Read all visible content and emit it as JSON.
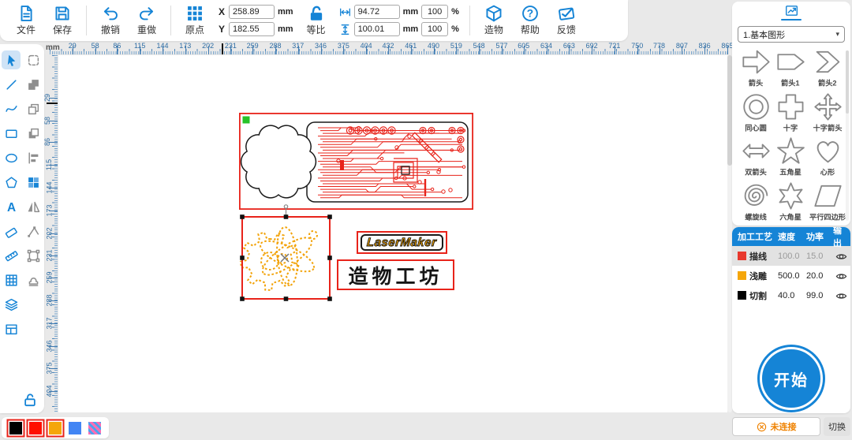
{
  "colors": {
    "accent": "#1584d6",
    "red": "#e8231a",
    "orange": "#f2a30a",
    "ruler_blue": "#2e6da4",
    "green_marker": "#27c227"
  },
  "toolbar": {
    "file_label": "文件",
    "save_label": "保存",
    "undo_label": "撤销",
    "redo_label": "重做",
    "origin_label": "原点",
    "x_label": "X",
    "x_value": "258.89",
    "y_label": "Y",
    "y_value": "182.55",
    "pos_unit": "mm",
    "lock_label": "等比",
    "width_value": "94.72",
    "height_value": "100.01",
    "size_unit": "mm",
    "width_percent": "100",
    "height_percent": "100",
    "percent_sign": "%",
    "build_label": "造物",
    "help_label": "帮助",
    "feedback_label": "反馈"
  },
  "left_toolbar": {
    "rows": [
      [
        "select",
        "marquee"
      ],
      [
        "line",
        "union"
      ],
      [
        "curve",
        "copy"
      ],
      [
        "rect",
        "subtract"
      ],
      [
        "ellipse",
        "align"
      ],
      [
        "polygon",
        "colorgrid"
      ],
      [
        "text",
        "mirror"
      ],
      [
        "eraser",
        "nodeedit"
      ],
      [
        "ruler",
        "frame"
      ],
      [
        "grid",
        "stamp"
      ],
      [
        "layers",
        null
      ],
      [
        "layout",
        null
      ]
    ],
    "active_tool": "select"
  },
  "rulers": {
    "unit": "mm",
    "h_numbers": [
      29,
      58,
      86,
      115,
      144,
      173,
      202,
      231,
      259,
      288,
      317,
      346,
      375,
      404,
      432,
      461,
      490,
      519,
      548,
      577,
      605,
      634,
      663,
      692,
      721,
      750,
      778,
      807,
      836,
      865
    ],
    "v_numbers": [
      29,
      58,
      86,
      115,
      144,
      173,
      202,
      231,
      259,
      288,
      317,
      346,
      375,
      404
    ]
  },
  "canvas": {
    "logo_text": "LaserMaker",
    "caption_text": "造物工坊",
    "objects": [
      "circuit-board-drawing",
      "gear-atom-group",
      "lasermaker-logo",
      "caption-text"
    ]
  },
  "palette": {
    "swatches": [
      {
        "id": "black",
        "color": "#000000",
        "outlined": true
      },
      {
        "id": "red",
        "color": "#ff0f00",
        "outlined": true
      },
      {
        "id": "orange",
        "color": "#f5a60a",
        "outlined": true
      },
      {
        "id": "blue",
        "color": "#4285f4",
        "outlined": false
      },
      {
        "id": "rainbow",
        "color": "rainbow",
        "outlined": false
      }
    ]
  },
  "library": {
    "category": "1.基本图形",
    "shapes": [
      {
        "id": "arrow",
        "label": "箭头"
      },
      {
        "id": "arrow1",
        "label": "箭头1"
      },
      {
        "id": "arrow2",
        "label": "箭头2"
      },
      {
        "id": "concentric",
        "label": "同心圆"
      },
      {
        "id": "cross",
        "label": "十字"
      },
      {
        "id": "cross_arrow",
        "label": "十字箭头"
      },
      {
        "id": "double_arrow",
        "label": "双箭头"
      },
      {
        "id": "star5",
        "label": "五角星"
      },
      {
        "id": "heart",
        "label": "心形"
      },
      {
        "id": "spiral",
        "label": "螺旋线"
      },
      {
        "id": "star6",
        "label": "六角星"
      },
      {
        "id": "parallelogram",
        "label": "平行四边形"
      }
    ]
  },
  "process": {
    "headers": [
      "加工工艺",
      "速度",
      "功率",
      "输出"
    ],
    "rows": [
      {
        "color": "#e8382d",
        "name": "描线",
        "speed": "100.0",
        "power": "15.0",
        "selected": true
      },
      {
        "color": "#f5a60a",
        "name": "浅雕",
        "speed": "500.0",
        "power": "20.0",
        "selected": false
      },
      {
        "color": "#000000",
        "name": "切割",
        "speed": "40.0",
        "power": "99.0",
        "selected": false
      }
    ]
  },
  "start": {
    "label": "开始"
  },
  "status": {
    "connection": "未连接",
    "switch_label": "切换"
  }
}
